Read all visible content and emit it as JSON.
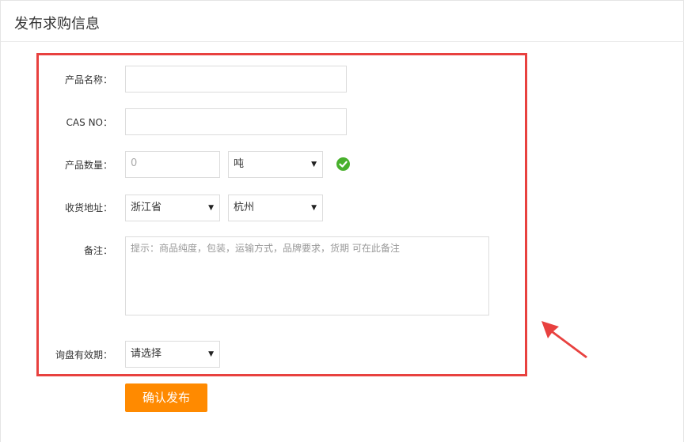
{
  "page": {
    "title": "发布求购信息"
  },
  "form": {
    "product_name": {
      "label": "产品名称：",
      "value": ""
    },
    "cas_no": {
      "label": "CAS NO：",
      "value": ""
    },
    "quantity": {
      "label": "产品数量：",
      "placeholder": "0",
      "unit": "吨"
    },
    "address": {
      "label": "收货地址：",
      "province": "浙江省",
      "city": "杭州"
    },
    "remark": {
      "label": "备注：",
      "placeholder": "提示：商品纯度，包装，运输方式，品牌要求，货期 可在此备注"
    },
    "validity": {
      "label": "询盘有效期：",
      "value": "请选择"
    },
    "submit_label": "确认发布"
  },
  "icons": {
    "caret": "▼",
    "check": "check-circle-icon"
  },
  "colors": {
    "highlight": "#e8413f",
    "accent": "#ff8a00",
    "check": "#48b02c"
  }
}
